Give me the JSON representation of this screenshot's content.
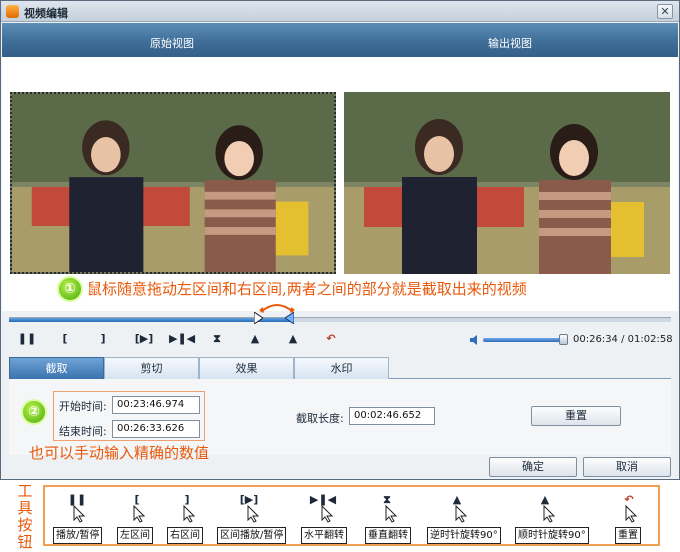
{
  "window": {
    "title": "视频编辑",
    "close_glyph": "✕"
  },
  "views": {
    "original_label": "原始视图",
    "output_label": "输出视图"
  },
  "annotation1": {
    "number": "①",
    "text": "鼠标随意拖动左区间和右区间,两者之间的部分就是截取出来的视频"
  },
  "seek": {
    "fill_fraction": 0.43,
    "left_handle_fraction": 0.375,
    "right_handle_fraction": 0.425
  },
  "controls": {
    "play_pause_icon": "pause-icon",
    "buttons": [
      "❚❚",
      "[",
      "]",
      "[▶]",
      "▶❚◀",
      "⧗",
      "▲",
      "▲",
      "↶"
    ],
    "volume_fraction": 0.9,
    "time": "00:26:34 / 01:02:58"
  },
  "tabs": [
    "截取",
    "剪切",
    "效果",
    "水印"
  ],
  "trim": {
    "start_label": "开始时间:",
    "start_value": "00:23:46.974",
    "end_label": "结束时间:",
    "end_value": "00:26:33.626",
    "length_label": "截取长度:",
    "length_value": "00:02:46.652",
    "reset_label": "重置"
  },
  "annotation2": {
    "number": "②",
    "text": "也可以手动输入精确的数值"
  },
  "footer": {
    "ok_label": "确定",
    "cancel_label": "取消"
  },
  "toolbar_legend": {
    "side_label": "工具按钮",
    "items": [
      {
        "icon": "❚❚",
        "label": "播放/暂停"
      },
      {
        "icon": "[",
        "label": "左区间"
      },
      {
        "icon": "]",
        "label": "右区间"
      },
      {
        "icon": "[▶]",
        "label": "区间播放/暂停"
      },
      {
        "icon": "▶❚◀",
        "label": "水平翻转"
      },
      {
        "icon": "⧗",
        "label": "垂直翻转"
      },
      {
        "icon": "▲",
        "label": "逆时针旋转90°"
      },
      {
        "icon": "▲",
        "label": "顺时针旋转90°"
      },
      {
        "icon": "↶",
        "label": "重置"
      }
    ]
  },
  "colors": {
    "accent": "#3f6e99",
    "annotation": "#e8590c",
    "circle_green": "#4ba80f"
  }
}
